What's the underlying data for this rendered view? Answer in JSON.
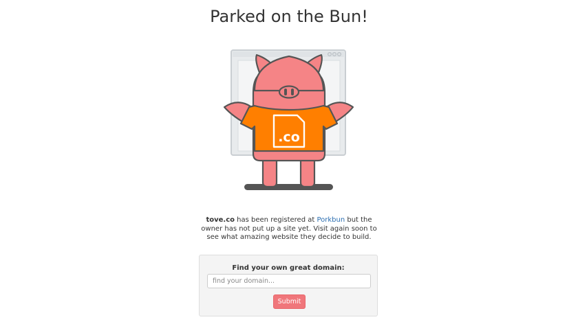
{
  "page": {
    "title": "Parked on the Bun!"
  },
  "illustration": {
    "tld_label": ".co",
    "colors": {
      "pig": "#f58486",
      "shirt": "#ff7f00",
      "outline": "#555555",
      "browser": "#e8ebed"
    }
  },
  "message": {
    "domain": "tove.co",
    "text_before_link": " has been registered at ",
    "link_text": "Porkbun",
    "text_after_link": " but the owner has not put up a site yet. Visit again soon to see what amazing website they decide to build."
  },
  "search": {
    "heading": "Find your own great domain:",
    "placeholder": "find your domain...",
    "submit_label": "Submit"
  }
}
